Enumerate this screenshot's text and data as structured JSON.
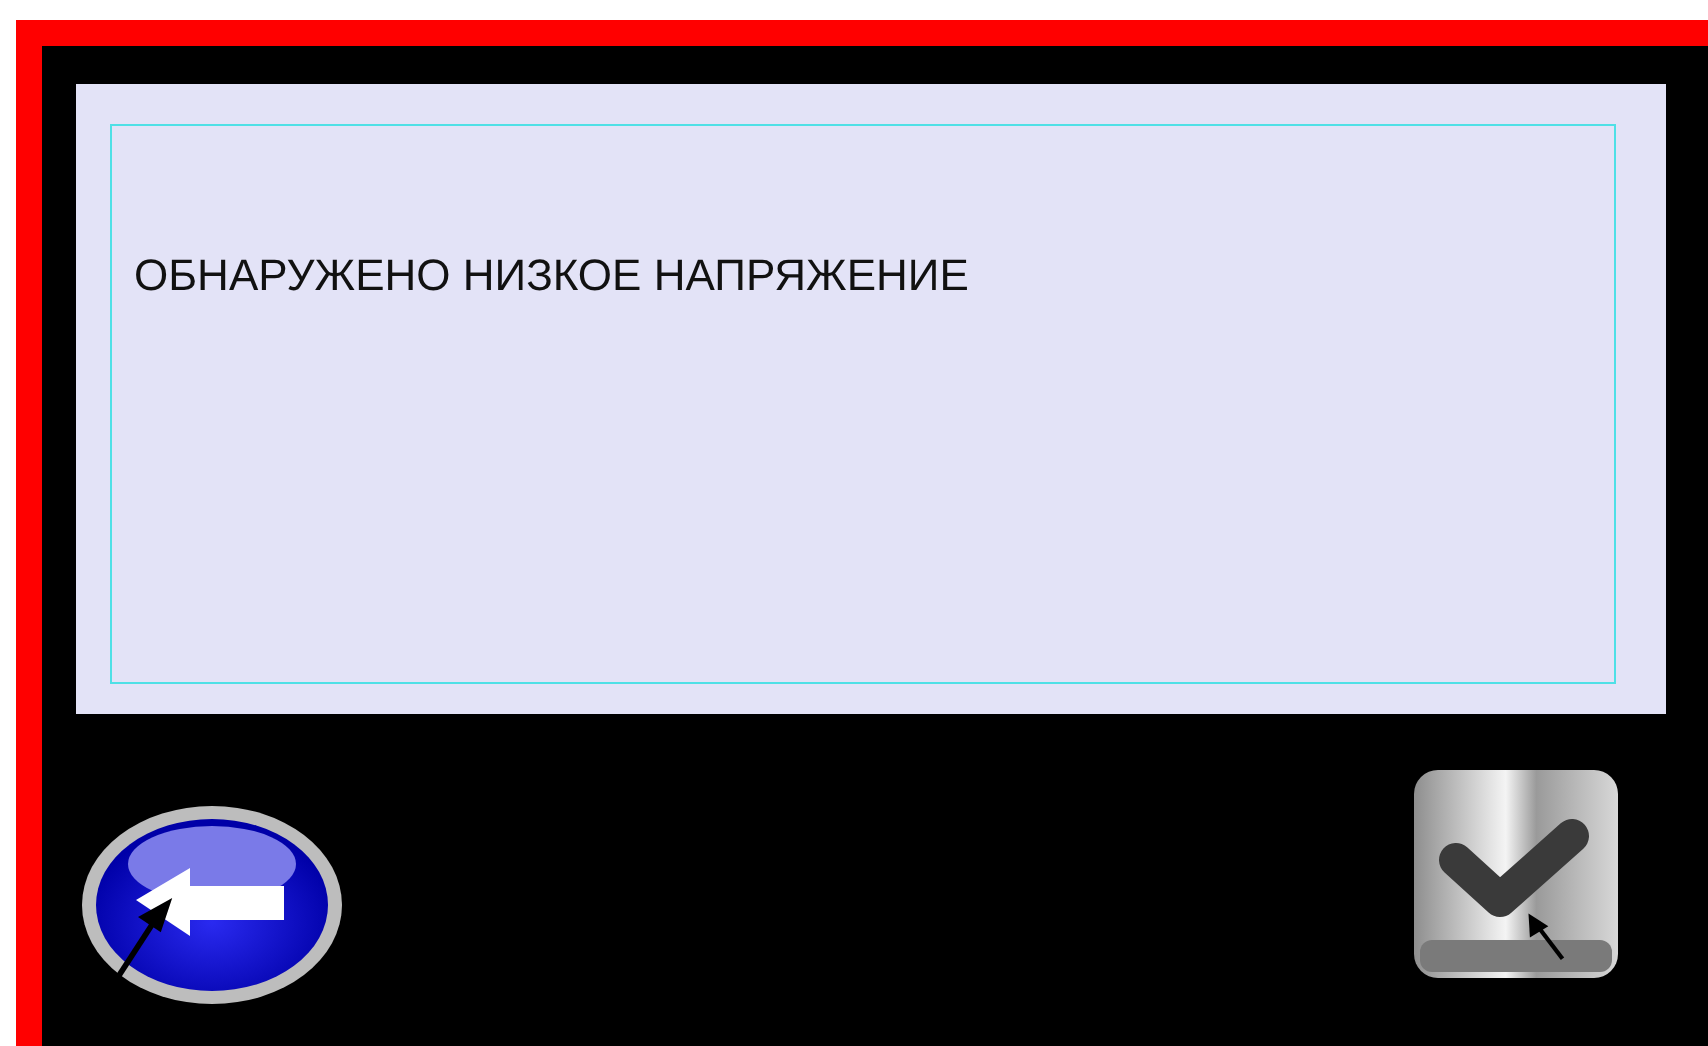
{
  "message": {
    "text": "ОБНАРУЖЕНО НИЗКОЕ НАПРЯЖЕНИЕ"
  },
  "buttons": [
    {
      "kind": "back"
    },
    {
      "kind": "confirm"
    }
  ]
}
